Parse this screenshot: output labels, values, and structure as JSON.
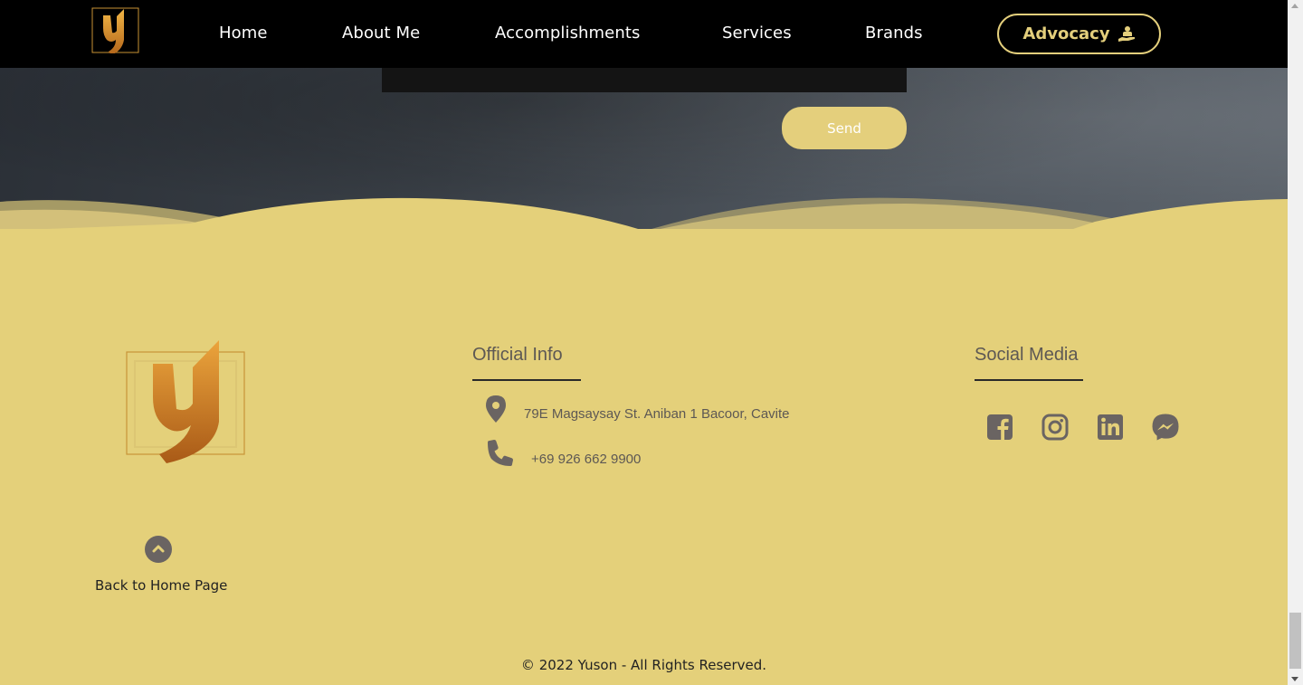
{
  "nav": {
    "items": [
      {
        "label": "Home"
      },
      {
        "label": "About Me"
      },
      {
        "label": "Accomplishments"
      },
      {
        "label": "Services"
      },
      {
        "label": "Brands"
      }
    ],
    "cta_label": "Advocacy",
    "cta_icon": "hand-holding-person-icon"
  },
  "contact": {
    "send_label": "Send"
  },
  "footer": {
    "back_to_home": "Back to Home Page",
    "official_info": {
      "heading": "Official Info",
      "address": "79E Magsaysay St. Aniban 1 Bacoor, Cavite",
      "phone": "+69 926 662 9900"
    },
    "social": {
      "heading": "Social Media",
      "icons": [
        "facebook-icon",
        "instagram-icon",
        "linkedin-icon",
        "messenger-icon"
      ]
    },
    "copyright": "© 2022 Yuson - All Rights Reserved."
  },
  "colors": {
    "gold": "#e4cf7c",
    "footer_bg": "#e4d07a",
    "nav_bg": "#000000",
    "icon_gray": "#6a6462"
  }
}
